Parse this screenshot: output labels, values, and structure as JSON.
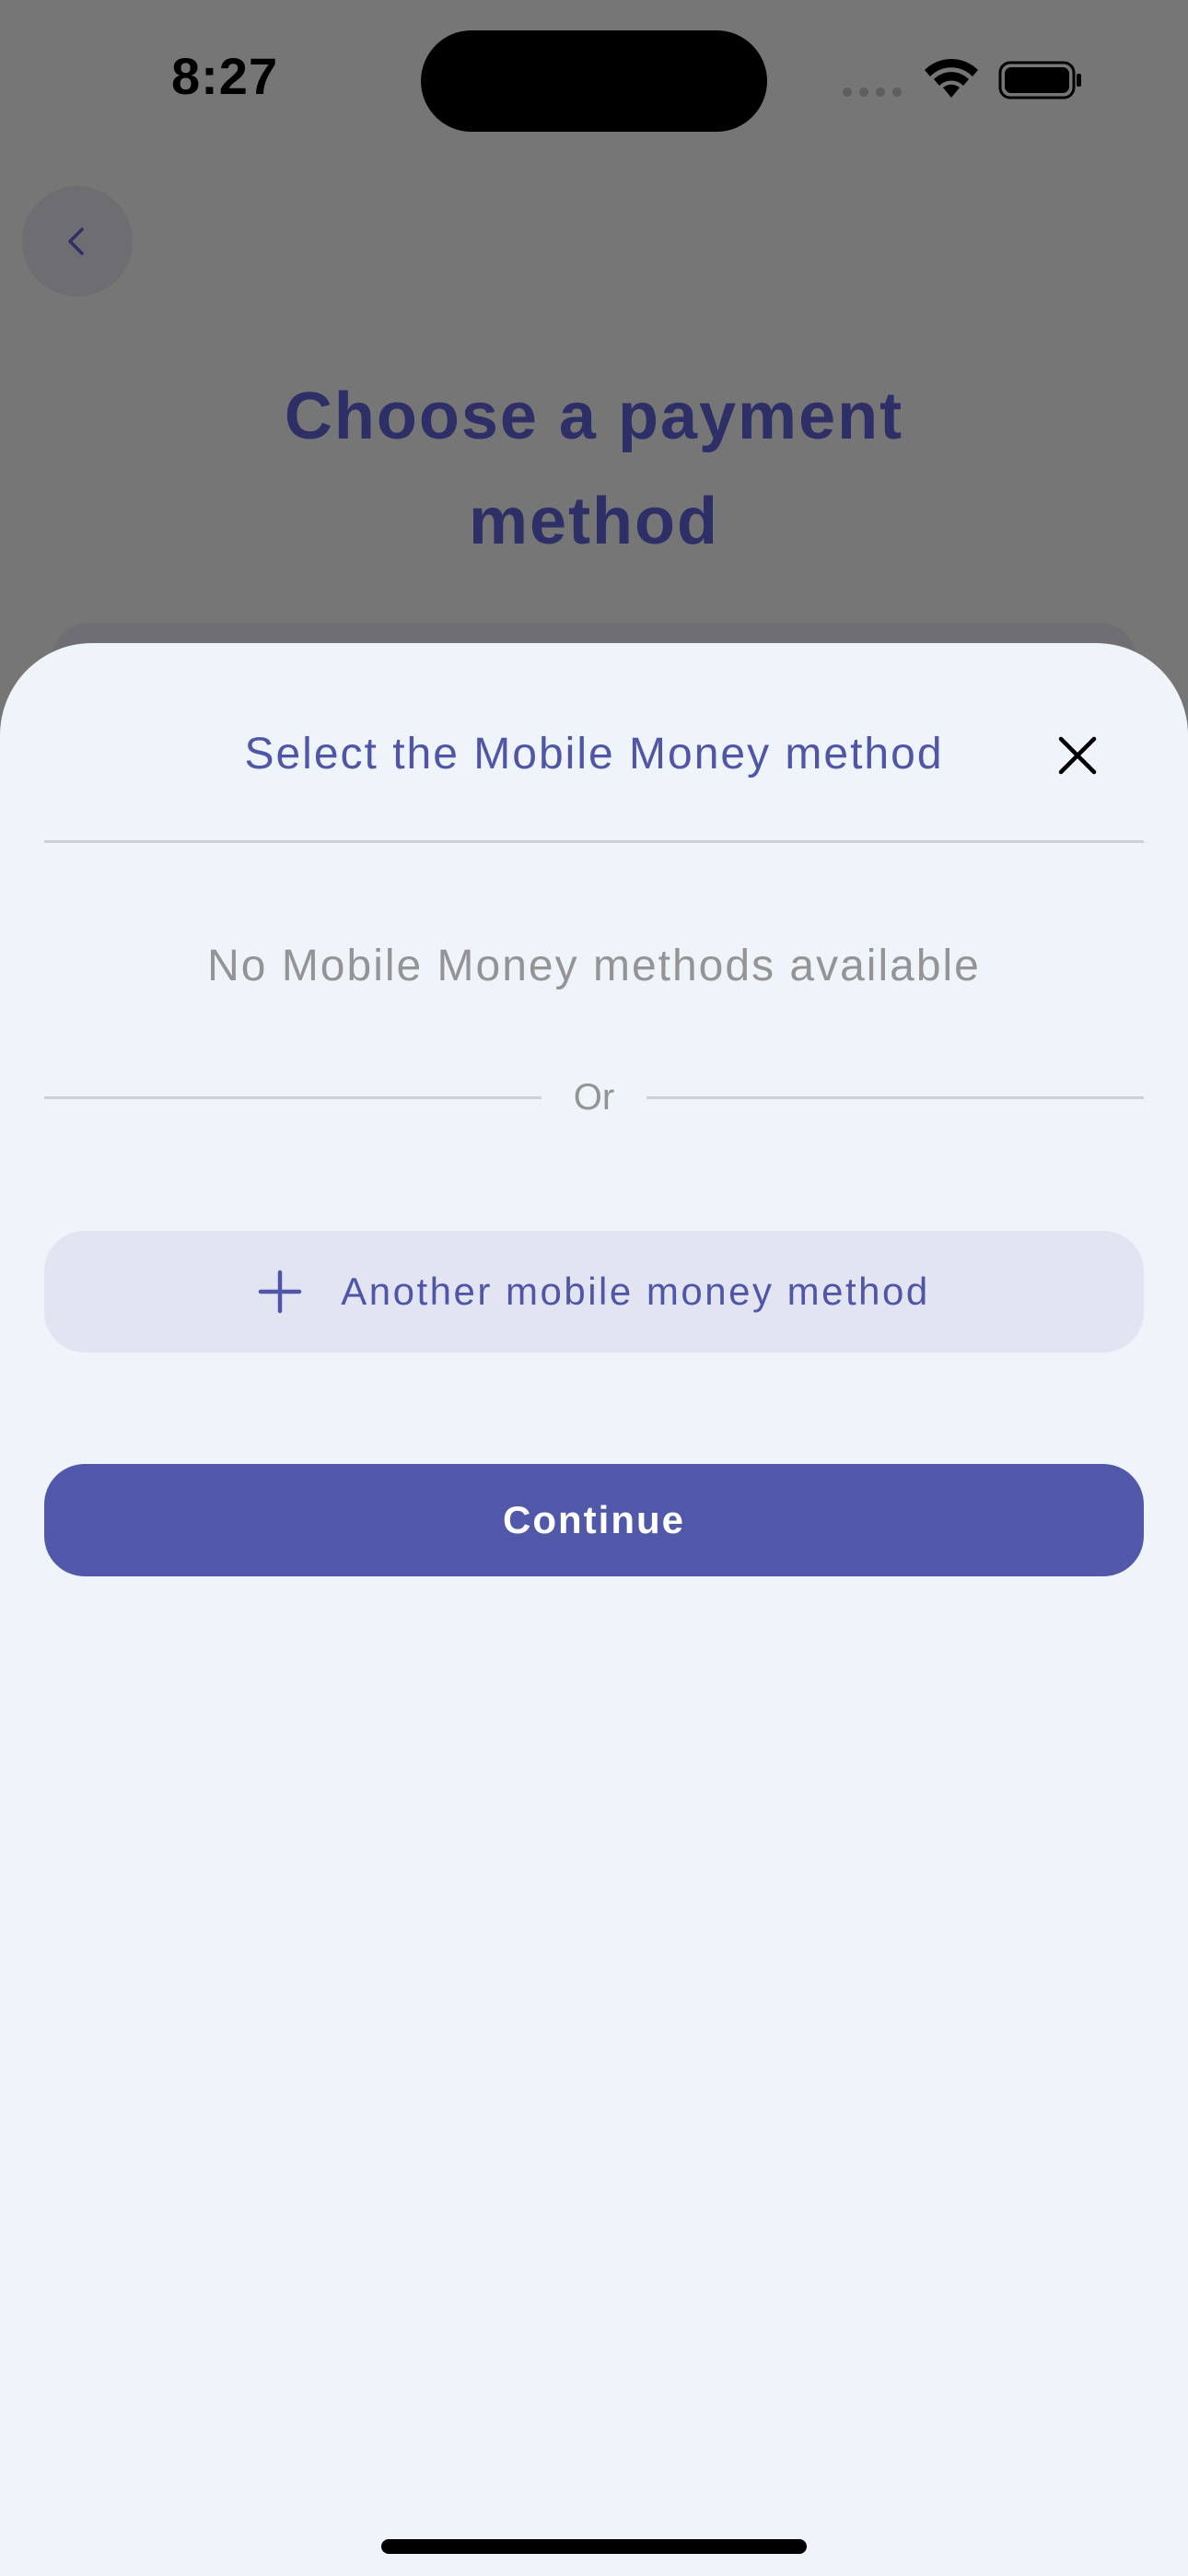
{
  "status_bar": {
    "time": "8:27",
    "icons": [
      "cellular-signal-icon",
      "wifi-icon",
      "battery-icon"
    ]
  },
  "background_screen": {
    "back_icon": "chevron-left-icon",
    "title_line1": "Choose a payment",
    "title_line2": "method"
  },
  "sheet": {
    "title": "Select the Mobile Money method",
    "close_icon": "close-icon",
    "empty_message": "No Mobile Money methods available",
    "separator_label": "Or",
    "add_method": {
      "icon": "plus-icon",
      "label": "Another mobile money method"
    },
    "continue_label": "Continue"
  },
  "colors": {
    "accent": "#5158aa",
    "accent_text": "#4f56a7",
    "title_dark": "#2d2f66",
    "sheet_background": "#eff3fa",
    "secondary_button_bg": "#e2e4f1",
    "muted_text": "#949494",
    "overlay": "#767676"
  }
}
